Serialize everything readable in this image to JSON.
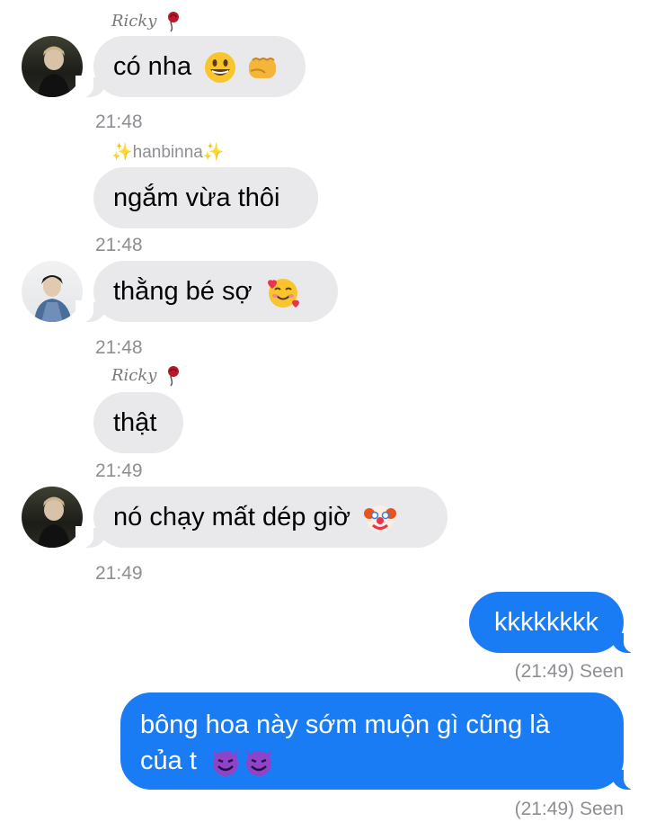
{
  "messages": [
    {
      "sender": "Ricky",
      "text": "có nha",
      "time": "21:48"
    },
    {
      "sender": "✨hanbinna✨",
      "text": "ngắm vừa thôi",
      "time": "21:48"
    },
    {
      "text": "thằng bé sợ",
      "time": "21:48"
    },
    {
      "sender": "Ricky",
      "text": "thật",
      "time": "21:49"
    },
    {
      "text": "nó chạy mất dép giờ",
      "time": "21:49"
    }
  ],
  "outgoing": [
    {
      "text": "kkkkkkkk",
      "status": "(21:49) Seen"
    },
    {
      "line1": "bông hoa này sớm muộn gì cũng là",
      "line2": "của t",
      "status": "(21:49) Seen"
    }
  ],
  "icons": [
    "grinning-face",
    "fist-bump",
    "smiling-face-with-hearts",
    "clown-face",
    "smiling-devil",
    "rose-flower"
  ],
  "colors": {
    "incoming": "#e9e9eb",
    "outgoing": "#1a7cf5",
    "meta": "#8e8e93"
  }
}
